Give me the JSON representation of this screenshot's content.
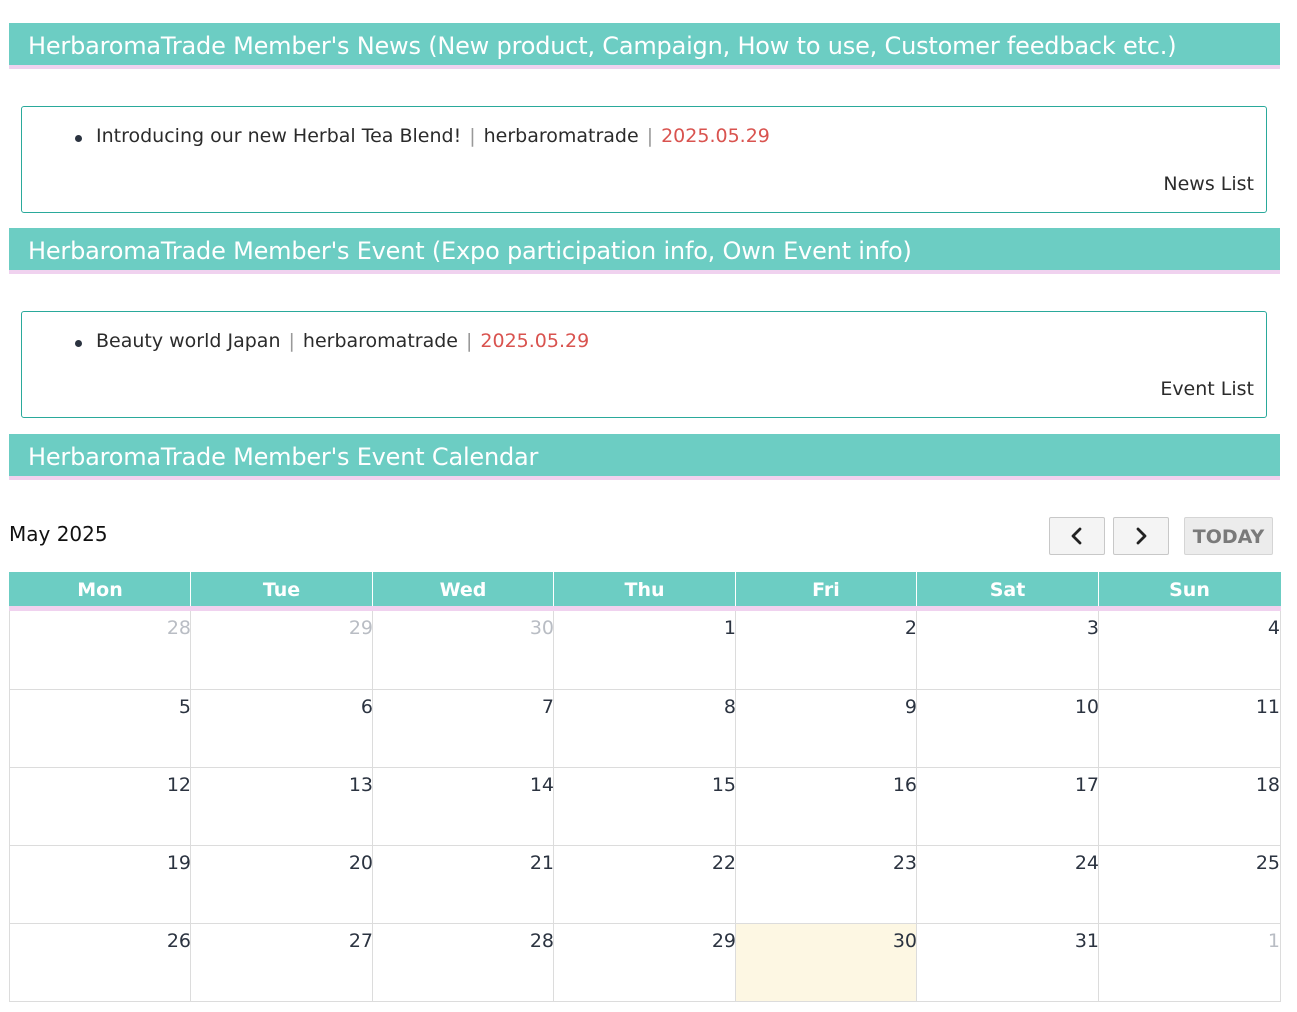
{
  "news": {
    "header_title": "HerbaromaTrade Member's News (New product, Campaign, How to use, Customer feedback etc.)",
    "items": [
      {
        "title": "Introducing our new Herbal Tea Blend!",
        "author": "herbaromatrade",
        "date": "2025.05.29"
      }
    ],
    "separator": "|",
    "list_link": "News List"
  },
  "events": {
    "header_title": "HerbaromaTrade Member's Event (Expo participation info, Own Event info)",
    "items": [
      {
        "title": "Beauty world Japan",
        "author": "herbaromatrade",
        "date": "2025.05.29"
      }
    ],
    "separator": "|",
    "list_link": "Event List"
  },
  "calendar": {
    "header_title": "HerbaromaTrade Member's Event Calendar",
    "month_label": "May 2025",
    "prev_icon": "chevron-left-icon",
    "next_icon": "chevron-right-icon",
    "today_label": "TODAY",
    "weekdays": [
      "Mon",
      "Tue",
      "Wed",
      "Thu",
      "Fri",
      "Sat",
      "Sun"
    ],
    "weeks": [
      [
        {
          "d": "28",
          "other": true
        },
        {
          "d": "29",
          "other": true
        },
        {
          "d": "30",
          "other": true
        },
        {
          "d": "1"
        },
        {
          "d": "2"
        },
        {
          "d": "3"
        },
        {
          "d": "4"
        }
      ],
      [
        {
          "d": "5"
        },
        {
          "d": "6"
        },
        {
          "d": "7"
        },
        {
          "d": "8"
        },
        {
          "d": "9"
        },
        {
          "d": "10"
        },
        {
          "d": "11"
        }
      ],
      [
        {
          "d": "12"
        },
        {
          "d": "13"
        },
        {
          "d": "14"
        },
        {
          "d": "15"
        },
        {
          "d": "16"
        },
        {
          "d": "17"
        },
        {
          "d": "18"
        }
      ],
      [
        {
          "d": "19"
        },
        {
          "d": "20"
        },
        {
          "d": "21"
        },
        {
          "d": "22"
        },
        {
          "d": "23"
        },
        {
          "d": "24"
        },
        {
          "d": "25"
        }
      ],
      [
        {
          "d": "26"
        },
        {
          "d": "27"
        },
        {
          "d": "28"
        },
        {
          "d": "29"
        },
        {
          "d": "30",
          "today": true
        },
        {
          "d": "31"
        },
        {
          "d": "1",
          "other": true
        }
      ]
    ],
    "colors": {
      "header_bg": "#6ccdc3",
      "header_underline": "#f0d2ef",
      "today_bg": "#fdf7e3",
      "date_accent": "#d9534f"
    }
  }
}
